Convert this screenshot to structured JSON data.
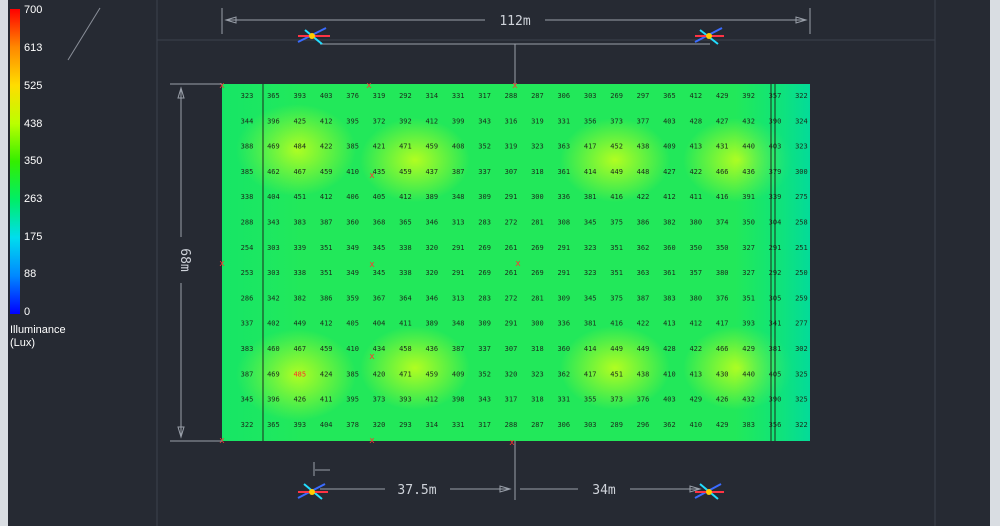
{
  "legend": {
    "title_line1": "Illuminance",
    "title_line2": "(Lux)",
    "ticks": [
      "700",
      "613",
      "525",
      "438",
      "350",
      "263",
      "175",
      "88",
      "0"
    ]
  },
  "dimensions": {
    "width": "112m",
    "height": "68m",
    "left_offset": "37.5m",
    "right_offset": "34m"
  },
  "colors": {
    "background": "#262a33",
    "low": "#00d97a",
    "high": "#a8ff22",
    "max_marker": "#ff2b2b"
  },
  "grid": {
    "rows": [
      [
        "323",
        "365",
        "393",
        "403",
        "376",
        "319",
        "292",
        "314",
        "331",
        "317",
        "288",
        "287",
        "306",
        "303",
        "269",
        "297",
        "365",
        "412",
        "429",
        "392",
        "357",
        "322"
      ],
      [
        "344",
        "396",
        "425",
        "412",
        "395",
        "372",
        "392",
        "412",
        "399",
        "343",
        "316",
        "319",
        "331",
        "356",
        "373",
        "377",
        "403",
        "428",
        "427",
        "432",
        "390",
        "324"
      ],
      [
        "388",
        "469",
        "484",
        "422",
        "385",
        "421",
        "471",
        "459",
        "408",
        "352",
        "319",
        "323",
        "363",
        "417",
        "452",
        "438",
        "409",
        "413",
        "431",
        "440",
        "403",
        "323"
      ],
      [
        "385",
        "462",
        "467",
        "459",
        "410",
        "435",
        "459",
        "437",
        "387",
        "337",
        "307",
        "318",
        "361",
        "414",
        "449",
        "448",
        "427",
        "422",
        "466",
        "436",
        "379",
        "300"
      ],
      [
        "338",
        "404",
        "451",
        "412",
        "406",
        "405",
        "412",
        "389",
        "348",
        "309",
        "291",
        "300",
        "336",
        "381",
        "416",
        "422",
        "412",
        "411",
        "416",
        "391",
        "339",
        "275"
      ],
      [
        "288",
        "343",
        "383",
        "387",
        "360",
        "368",
        "365",
        "346",
        "313",
        "283",
        "272",
        "281",
        "308",
        "345",
        "375",
        "386",
        "382",
        "380",
        "374",
        "350",
        "304",
        "258"
      ],
      [
        "254",
        "303",
        "339",
        "351",
        "349",
        "345",
        "338",
        "320",
        "291",
        "269",
        "261",
        "269",
        "291",
        "323",
        "351",
        "362",
        "360",
        "350",
        "350",
        "327",
        "291",
        "251"
      ],
      [
        "253",
        "303",
        "338",
        "351",
        "349",
        "345",
        "338",
        "320",
        "291",
        "269",
        "261",
        "269",
        "291",
        "323",
        "351",
        "363",
        "361",
        "357",
        "380",
        "327",
        "292",
        "250"
      ],
      [
        "286",
        "342",
        "382",
        "386",
        "359",
        "367",
        "364",
        "346",
        "313",
        "283",
        "272",
        "281",
        "309",
        "345",
        "375",
        "387",
        "383",
        "380",
        "376",
        "351",
        "305",
        "259"
      ],
      [
        "337",
        "402",
        "449",
        "412",
        "405",
        "404",
        "411",
        "389",
        "348",
        "309",
        "291",
        "300",
        "336",
        "381",
        "416",
        "422",
        "413",
        "412",
        "417",
        "393",
        "341",
        "277"
      ],
      [
        "383",
        "460",
        "467",
        "459",
        "410",
        "434",
        "458",
        "436",
        "387",
        "337",
        "307",
        "318",
        "360",
        "414",
        "449",
        "449",
        "428",
        "422",
        "466",
        "429",
        "381",
        "302"
      ],
      [
        "387",
        "469",
        "485",
        "424",
        "385",
        "420",
        "471",
        "459",
        "409",
        "352",
        "320",
        "323",
        "362",
        "417",
        "451",
        "438",
        "410",
        "413",
        "430",
        "440",
        "405",
        "325"
      ],
      [
        "345",
        "396",
        "426",
        "411",
        "395",
        "373",
        "393",
        "412",
        "398",
        "343",
        "317",
        "318",
        "331",
        "355",
        "373",
        "376",
        "403",
        "429",
        "426",
        "432",
        "390",
        "325"
      ],
      [
        "322",
        "365",
        "393",
        "404",
        "378",
        "320",
        "293",
        "314",
        "331",
        "317",
        "288",
        "287",
        "306",
        "303",
        "289",
        "296",
        "362",
        "410",
        "429",
        "383",
        "356",
        "322"
      ]
    ]
  }
}
